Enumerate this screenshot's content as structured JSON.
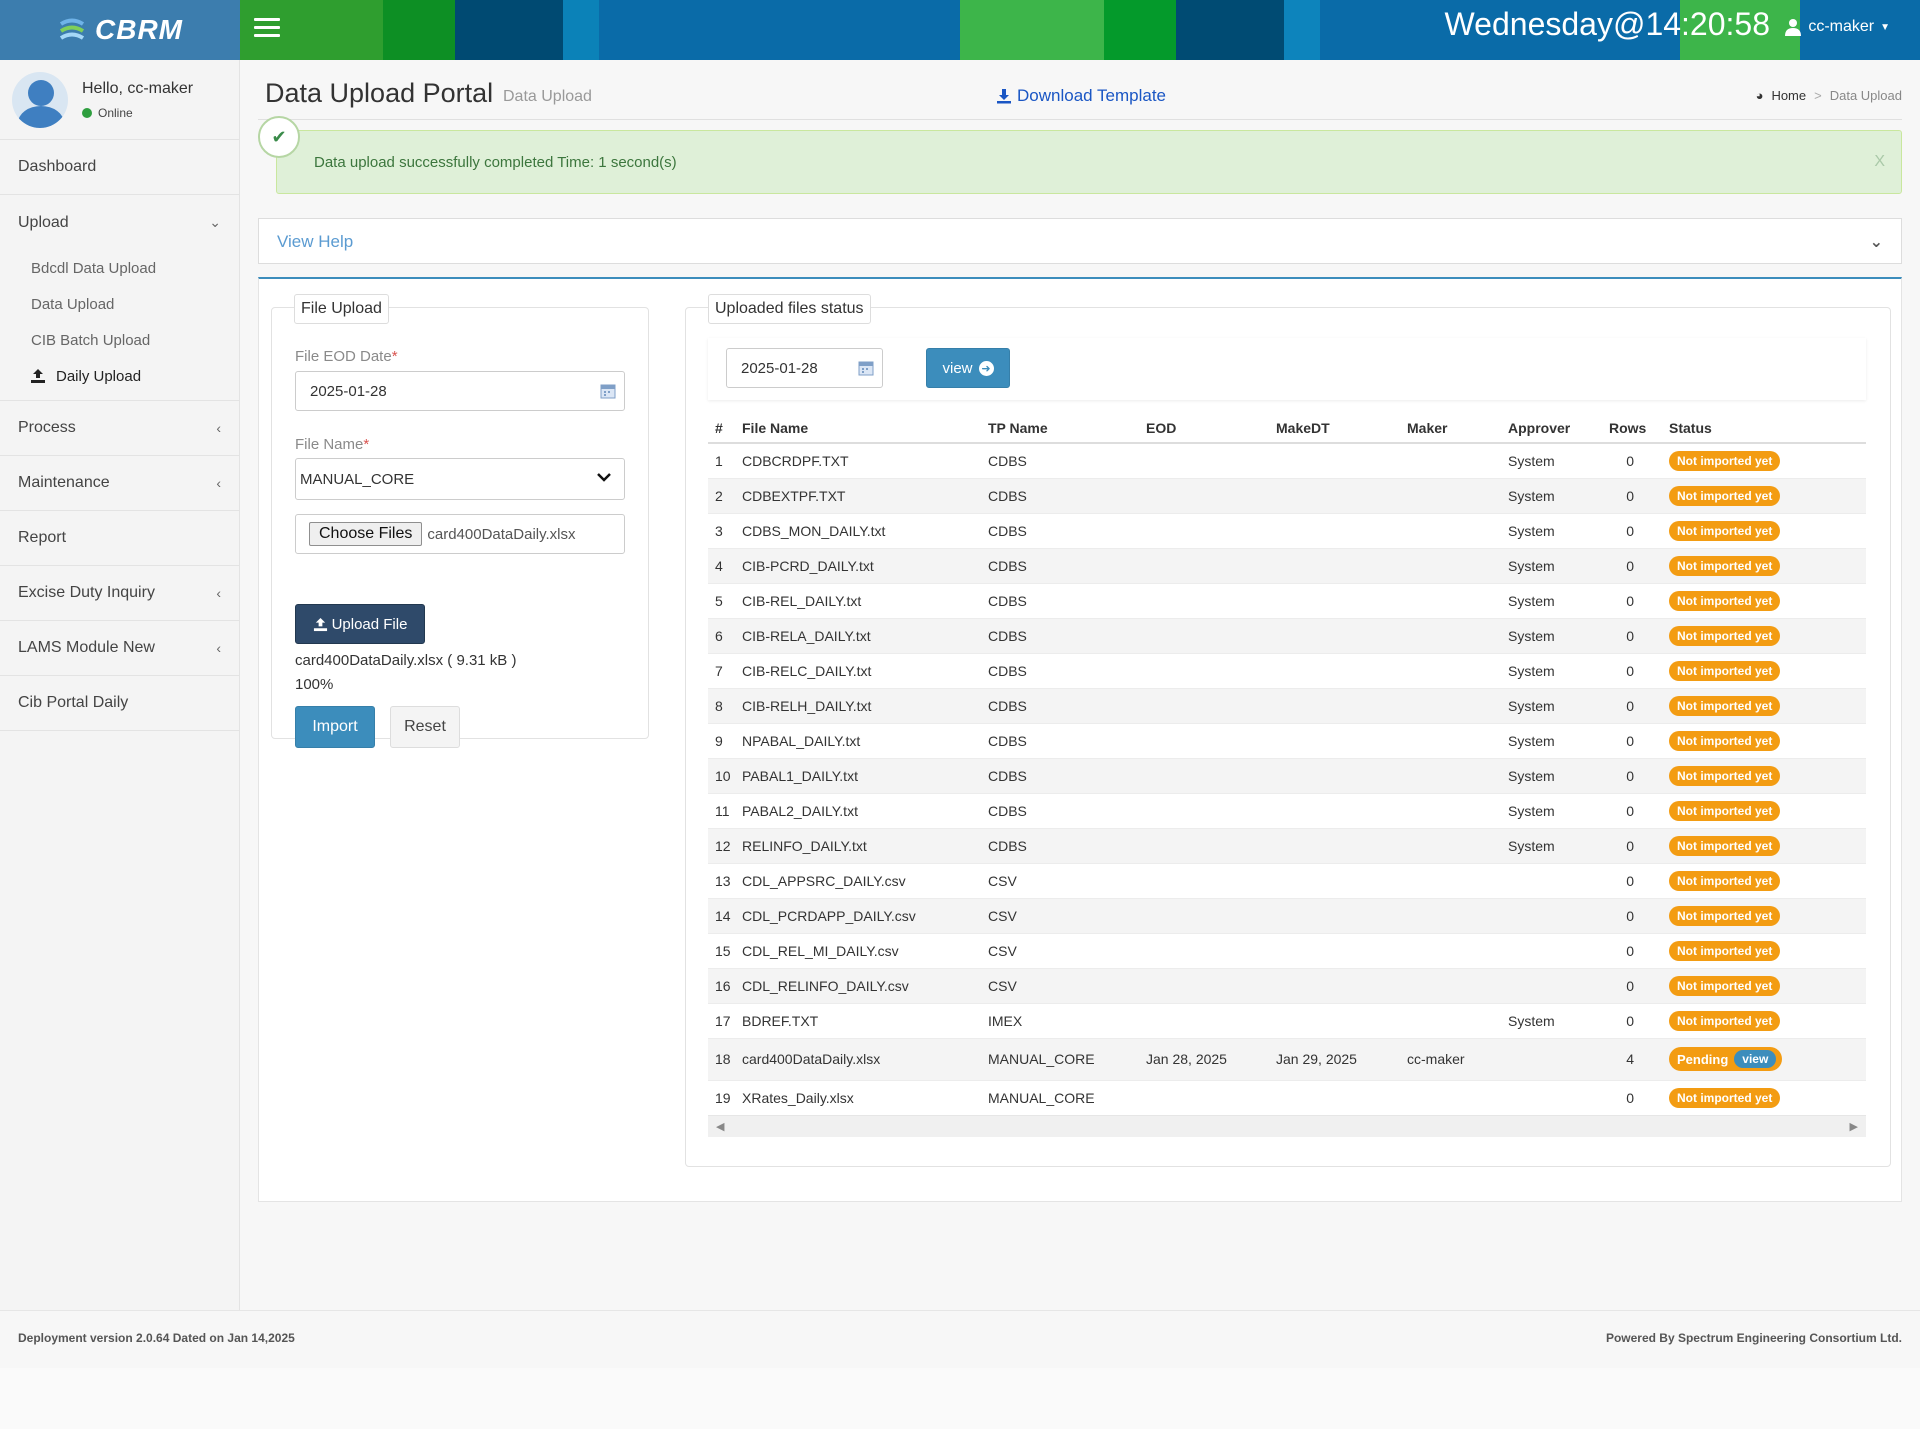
{
  "app": {
    "logo_text": "CBRM",
    "clock": "Wednesday@14:20:58",
    "user_menu": "cc-maker"
  },
  "sidebar": {
    "greeting": "Hello, cc-maker",
    "status": "Online",
    "items": {
      "dashboard": "Dashboard",
      "upload": "Upload",
      "upload_sub": [
        "Bdcdl Data Upload",
        "Data Upload",
        "CIB Batch Upload",
        "Daily Upload"
      ],
      "process": "Process",
      "maintenance": "Maintenance",
      "report": "Report",
      "excise": "Excise Duty Inquiry",
      "lams": "LAMS Module New",
      "cib_portal": "Cib Portal Daily"
    }
  },
  "header": {
    "title": "Data Upload Portal",
    "subtitle": "Data Upload",
    "download": "Download Template",
    "breadcrumb_home": "Home",
    "breadcrumb_sep": ">",
    "breadcrumb_current": "Data Upload"
  },
  "alert": {
    "message": "Data upload successfully completed Time: 1 second(s)",
    "close": "X"
  },
  "help": {
    "title": "View Help"
  },
  "file_upload": {
    "legend": "File Upload",
    "eod_label": "File EOD Date",
    "eod_value": "2025-01-28",
    "required_mark": "*",
    "name_label": "File Name",
    "name_value": "MANUAL_CORE",
    "choose_label": "Choose Files",
    "chosen_file": "card400DataDaily.xlsx",
    "upload_label": "Upload File",
    "file_info": "card400DataDaily.xlsx ( 9.31 kB )",
    "progress": "100%",
    "import_label": "Import",
    "reset_label": "Reset"
  },
  "status": {
    "legend": "Uploaded files status",
    "date_value": "2025-01-28",
    "view_label": "view",
    "headers": [
      "#",
      "File Name",
      "TP Name",
      "EOD",
      "MakeDT",
      "Maker",
      "Approver",
      "Rows",
      "Status"
    ],
    "rows": [
      {
        "n": "1",
        "file": "CDBCRDPF.TXT",
        "tp": "CDBS",
        "eod": "",
        "make": "",
        "maker": "",
        "approver": "System",
        "rows": "0",
        "status": "Not imported yet"
      },
      {
        "n": "2",
        "file": "CDBEXTPF.TXT",
        "tp": "CDBS",
        "eod": "",
        "make": "",
        "maker": "",
        "approver": "System",
        "rows": "0",
        "status": "Not imported yet"
      },
      {
        "n": "3",
        "file": "CDBS_MON_DAILY.txt",
        "tp": "CDBS",
        "eod": "",
        "make": "",
        "maker": "",
        "approver": "System",
        "rows": "0",
        "status": "Not imported yet"
      },
      {
        "n": "4",
        "file": "CIB-PCRD_DAILY.txt",
        "tp": "CDBS",
        "eod": "",
        "make": "",
        "maker": "",
        "approver": "System",
        "rows": "0",
        "status": "Not imported yet"
      },
      {
        "n": "5",
        "file": "CIB-REL_DAILY.txt",
        "tp": "CDBS",
        "eod": "",
        "make": "",
        "maker": "",
        "approver": "System",
        "rows": "0",
        "status": "Not imported yet"
      },
      {
        "n": "6",
        "file": "CIB-RELA_DAILY.txt",
        "tp": "CDBS",
        "eod": "",
        "make": "",
        "maker": "",
        "approver": "System",
        "rows": "0",
        "status": "Not imported yet"
      },
      {
        "n": "7",
        "file": "CIB-RELC_DAILY.txt",
        "tp": "CDBS",
        "eod": "",
        "make": "",
        "maker": "",
        "approver": "System",
        "rows": "0",
        "status": "Not imported yet"
      },
      {
        "n": "8",
        "file": "CIB-RELH_DAILY.txt",
        "tp": "CDBS",
        "eod": "",
        "make": "",
        "maker": "",
        "approver": "System",
        "rows": "0",
        "status": "Not imported yet"
      },
      {
        "n": "9",
        "file": "NPABAL_DAILY.txt",
        "tp": "CDBS",
        "eod": "",
        "make": "",
        "maker": "",
        "approver": "System",
        "rows": "0",
        "status": "Not imported yet"
      },
      {
        "n": "10",
        "file": "PABAL1_DAILY.txt",
        "tp": "CDBS",
        "eod": "",
        "make": "",
        "maker": "",
        "approver": "System",
        "rows": "0",
        "status": "Not imported yet"
      },
      {
        "n": "11",
        "file": "PABAL2_DAILY.txt",
        "tp": "CDBS",
        "eod": "",
        "make": "",
        "maker": "",
        "approver": "System",
        "rows": "0",
        "status": "Not imported yet"
      },
      {
        "n": "12",
        "file": "RELINFO_DAILY.txt",
        "tp": "CDBS",
        "eod": "",
        "make": "",
        "maker": "",
        "approver": "System",
        "rows": "0",
        "status": "Not imported yet"
      },
      {
        "n": "13",
        "file": "CDL_APPSRC_DAILY.csv",
        "tp": "CSV",
        "eod": "",
        "make": "",
        "maker": "",
        "approver": "",
        "rows": "0",
        "status": "Not imported yet"
      },
      {
        "n": "14",
        "file": "CDL_PCRDAPP_DAILY.csv",
        "tp": "CSV",
        "eod": "",
        "make": "",
        "maker": "",
        "approver": "",
        "rows": "0",
        "status": "Not imported yet"
      },
      {
        "n": "15",
        "file": "CDL_REL_MI_DAILY.csv",
        "tp": "CSV",
        "eod": "",
        "make": "",
        "maker": "",
        "approver": "",
        "rows": "0",
        "status": "Not imported yet"
      },
      {
        "n": "16",
        "file": "CDL_RELINFO_DAILY.csv",
        "tp": "CSV",
        "eod": "",
        "make": "",
        "maker": "",
        "approver": "",
        "rows": "0",
        "status": "Not imported yet"
      },
      {
        "n": "17",
        "file": "BDREF.TXT",
        "tp": "IMEX",
        "eod": "",
        "make": "",
        "maker": "",
        "approver": "System",
        "rows": "0",
        "status": "Not imported yet"
      },
      {
        "n": "18",
        "file": "card400DataDaily.xlsx",
        "tp": "MANUAL_CORE",
        "eod": "Jan 28, 2025",
        "make": "Jan 29, 2025",
        "maker": "cc-maker",
        "approver": "",
        "rows": "4",
        "status": "Pending",
        "action": "view"
      },
      {
        "n": "19",
        "file": "XRates_Daily.xlsx",
        "tp": "MANUAL_CORE",
        "eod": "",
        "make": "",
        "maker": "",
        "approver": "",
        "rows": "0",
        "status": "Not imported yet"
      }
    ]
  },
  "footer": {
    "left": "Deployment version 2.0.64 Dated on Jan 14,2025",
    "right": "Powered By Spectrum Engineering Consortium Ltd."
  },
  "colors": {
    "brand_blue": "#3c7dae",
    "primary": "#3c8dbc",
    "warning": "#f39c12",
    "success_bg": "#dff0d8"
  },
  "icons": [
    "menu-icon",
    "user-icon",
    "calendar-icon",
    "chevron-down-icon",
    "upload-icon",
    "download-icon",
    "check-icon",
    "arrow-right-circle-icon",
    "dashboard-icon"
  ]
}
